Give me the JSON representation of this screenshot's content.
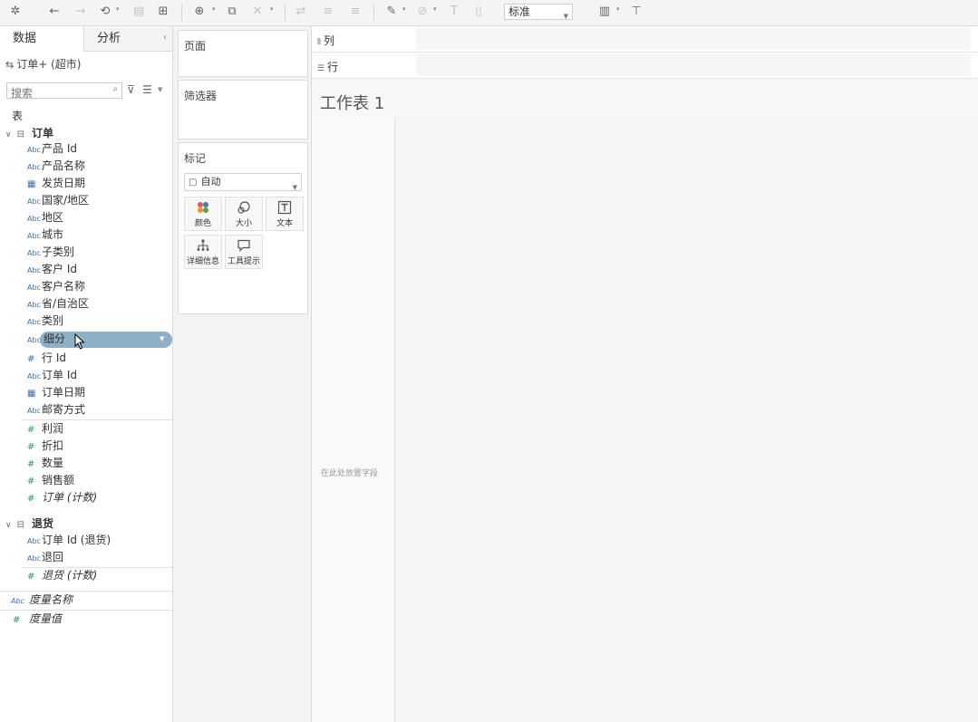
{
  "colors": {
    "selected_field": "#8db0c6",
    "dimension_icon": "#3b6fb6",
    "measure_icon": "#2f9a57"
  },
  "toolbar": {
    "icons": [
      "tableau-logo-icon",
      "undo-icon",
      "redo-icon",
      "refresh-icon",
      "save-icon",
      "new-datasource-icon",
      "new-worksheet-icon",
      "duplicate-sheet-icon",
      "clear-sheet-icon",
      "swap-icon",
      "sort-asc-icon",
      "sort-desc-icon",
      "highlight-icon",
      "group-icon",
      "labels-icon",
      "fit-icon",
      "show-me-icon",
      "presentation-icon"
    ],
    "fit_value": "标准"
  },
  "data_pane": {
    "tabs": [
      "数据",
      "分析"
    ],
    "datasource": "订单+ (超市)",
    "search_placeholder": "搜索",
    "tables_heading": "表",
    "groups": [
      {
        "name": "订单",
        "fields": [
          {
            "label": "产品 Id",
            "type": "string"
          },
          {
            "label": "产品名称",
            "type": "string"
          },
          {
            "label": "发货日期",
            "type": "date"
          },
          {
            "label": "国家/地区",
            "type": "string"
          },
          {
            "label": "地区",
            "type": "string"
          },
          {
            "label": "城市",
            "type": "string"
          },
          {
            "label": "子类别",
            "type": "string"
          },
          {
            "label": "客户 Id",
            "type": "string"
          },
          {
            "label": "客户名称",
            "type": "string"
          },
          {
            "label": "省/自治区",
            "type": "string"
          },
          {
            "label": "类别",
            "type": "string"
          },
          {
            "label": "细分",
            "type": "string"
          },
          {
            "label": "行 Id",
            "type": "number"
          },
          {
            "label": "订单 Id",
            "type": "string"
          },
          {
            "label": "订单日期",
            "type": "date"
          },
          {
            "label": "邮寄方式",
            "type": "string"
          }
        ],
        "measures": [
          {
            "label": "利润"
          },
          {
            "label": "折扣"
          },
          {
            "label": "数量"
          },
          {
            "label": "销售额"
          },
          {
            "label": "订单 (计数)"
          }
        ]
      },
      {
        "name": "退货",
        "fields": [
          {
            "label": "订单 Id (退货)",
            "type": "string"
          },
          {
            "label": "退回",
            "type": "string"
          }
        ],
        "measures": [
          {
            "label": "退货 (计数)"
          }
        ]
      }
    ],
    "measure_names": "度量名称",
    "measure_values": "度量值",
    "selected_field": "细分"
  },
  "shelves": {
    "pages": "页面",
    "filters": "筛选器",
    "marks": "标记",
    "mark_type": "自动",
    "mark_buttons": [
      {
        "label": "颜色",
        "icon": "color-icon"
      },
      {
        "label": "大小",
        "icon": "size-icon"
      },
      {
        "label": "文本",
        "icon": "text-icon"
      },
      {
        "label": "详细信息",
        "icon": "detail-icon"
      },
      {
        "label": "工具提示",
        "icon": "tooltip-icon"
      }
    ],
    "columns": "列",
    "rows": "行"
  },
  "canvas": {
    "sheet_title": "工作表 1",
    "drop_hint": "在此处放置字段"
  }
}
